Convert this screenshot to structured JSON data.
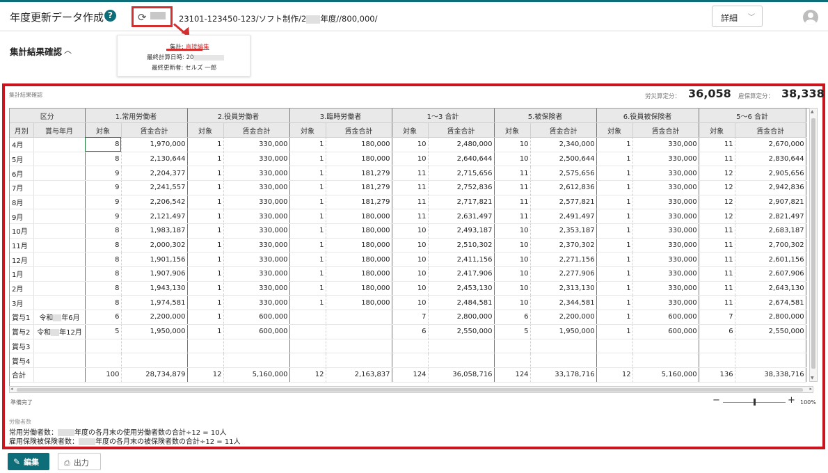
{
  "header": {
    "title": "年度更新データ作成",
    "help": "?",
    "path_prefix": "23101-123450-123/ソフト制作/2",
    "path_suffix": "年度//800,000/",
    "detail_label": "詳細",
    "history_icon": "history-icon",
    "chevron_icon": "chevron-down-icon",
    "user_icon": "user-avatar-icon"
  },
  "section": {
    "title": "集計結果確認",
    "toggle_icon": "chevron-up-icon"
  },
  "card": {
    "aggregate_label": "集計:",
    "aggregate_link": "直接編集",
    "last_calc_label": "最終計算日時:",
    "last_calc_value": "20",
    "last_user_label": "最終更新者:",
    "last_user_value": "セルズ 一郎"
  },
  "panel": {
    "title": "集計結果確認",
    "rousai_label": "労災算定分：",
    "rousai_value": "36,058",
    "koyou_label": "雇保算定分：",
    "koyou_value": "38,338"
  },
  "grid": {
    "group_headers": [
      "区分",
      "1.常用労働者",
      "2.役員労働者",
      "3.臨時労働者",
      "1～3 合計",
      "5.被保険者",
      "6.役員被保険者",
      "5～6 合計"
    ],
    "sub_headers": [
      "月別",
      "賞与年月",
      "対象",
      "賃金合計",
      "対象",
      "賃金合計",
      "対象",
      "賃金合計",
      "対象",
      "賃金合計",
      "対象",
      "賃金合計",
      "対象",
      "賃金合計",
      "対象",
      "賃金合計"
    ],
    "rows": [
      {
        "m": "4月",
        "b": "",
        "c": [
          "8",
          "1,970,000",
          "1",
          "330,000",
          "1",
          "180,000",
          "10",
          "2,480,000",
          "10",
          "2,340,000",
          "1",
          "330,000",
          "11",
          "2,670,000"
        ]
      },
      {
        "m": "5月",
        "b": "",
        "c": [
          "8",
          "2,130,644",
          "1",
          "330,000",
          "1",
          "180,000",
          "10",
          "2,640,644",
          "10",
          "2,500,644",
          "1",
          "330,000",
          "11",
          "2,830,644"
        ]
      },
      {
        "m": "6月",
        "b": "",
        "c": [
          "9",
          "2,204,377",
          "1",
          "330,000",
          "1",
          "181,279",
          "11",
          "2,715,656",
          "11",
          "2,575,656",
          "1",
          "330,000",
          "12",
          "2,905,656"
        ]
      },
      {
        "m": "7月",
        "b": "",
        "c": [
          "9",
          "2,241,557",
          "1",
          "330,000",
          "1",
          "181,279",
          "11",
          "2,752,836",
          "11",
          "2,612,836",
          "1",
          "330,000",
          "12",
          "2,942,836"
        ]
      },
      {
        "m": "8月",
        "b": "",
        "c": [
          "9",
          "2,206,542",
          "1",
          "330,000",
          "1",
          "181,279",
          "11",
          "2,717,821",
          "11",
          "2,577,821",
          "1",
          "330,000",
          "12",
          "2,907,821"
        ]
      },
      {
        "m": "9月",
        "b": "",
        "c": [
          "9",
          "2,121,497",
          "1",
          "330,000",
          "1",
          "180,000",
          "11",
          "2,631,497",
          "11",
          "2,491,497",
          "1",
          "330,000",
          "12",
          "2,821,497"
        ]
      },
      {
        "m": "10月",
        "b": "",
        "c": [
          "8",
          "1,983,187",
          "1",
          "330,000",
          "1",
          "180,000",
          "10",
          "2,493,187",
          "10",
          "2,353,187",
          "1",
          "330,000",
          "11",
          "2,683,187"
        ]
      },
      {
        "m": "11月",
        "b": "",
        "c": [
          "8",
          "2,000,302",
          "1",
          "330,000",
          "1",
          "180,000",
          "10",
          "2,510,302",
          "10",
          "2,370,302",
          "1",
          "330,000",
          "11",
          "2,700,302"
        ]
      },
      {
        "m": "12月",
        "b": "",
        "c": [
          "8",
          "1,901,156",
          "1",
          "330,000",
          "1",
          "180,000",
          "10",
          "2,411,156",
          "10",
          "2,271,156",
          "1",
          "330,000",
          "11",
          "2,601,156"
        ]
      },
      {
        "m": "1月",
        "b": "",
        "c": [
          "8",
          "1,907,906",
          "1",
          "330,000",
          "1",
          "180,000",
          "10",
          "2,417,906",
          "10",
          "2,277,906",
          "1",
          "330,000",
          "11",
          "2,607,906"
        ]
      },
      {
        "m": "2月",
        "b": "",
        "c": [
          "8",
          "1,943,130",
          "1",
          "330,000",
          "1",
          "180,000",
          "10",
          "2,453,130",
          "10",
          "2,313,130",
          "1",
          "330,000",
          "11",
          "2,643,130"
        ]
      },
      {
        "m": "3月",
        "b": "",
        "c": [
          "8",
          "1,974,581",
          "1",
          "330,000",
          "1",
          "180,000",
          "10",
          "2,484,581",
          "10",
          "2,344,581",
          "1",
          "330,000",
          "11",
          "2,674,581"
        ]
      },
      {
        "m": "賞与1",
        "b": "令和 年6月",
        "c": [
          "6",
          "2,200,000",
          "1",
          "600,000",
          "",
          "",
          "7",
          "2,800,000",
          "6",
          "2,200,000",
          "1",
          "600,000",
          "7",
          "2,800,000"
        ]
      },
      {
        "m": "賞与2",
        "b": "令和 年12月",
        "c": [
          "5",
          "1,950,000",
          "1",
          "600,000",
          "",
          "",
          "6",
          "2,550,000",
          "5",
          "1,950,000",
          "1",
          "600,000",
          "6",
          "2,550,000"
        ]
      },
      {
        "m": "賞与3",
        "b": "",
        "c": [
          "",
          "",
          "",
          "",
          "",
          "",
          "",
          "",
          "",
          "",
          "",
          "",
          "",
          ""
        ]
      },
      {
        "m": "賞与4",
        "b": "",
        "c": [
          "",
          "",
          "",
          "",
          "",
          "",
          "",
          "",
          "",
          "",
          "",
          "",
          "",
          ""
        ]
      },
      {
        "m": "合計",
        "b": "",
        "c": [
          "100",
          "28,734,879",
          "12",
          "5,160,000",
          "12",
          "2,163,837",
          "124",
          "36,058,716",
          "124",
          "33,178,716",
          "12",
          "5,160,000",
          "136",
          "38,338,716"
        ]
      }
    ]
  },
  "status": {
    "text": "準備完了",
    "zoom_minus": "−",
    "zoom_plus": "+",
    "zoom": "100%",
    "zoom_level": 0.5
  },
  "notes": {
    "title": "労働者数",
    "line1_prefix": "常用労働者数：",
    "line1_suffix": "年度の各月末の使用労働者数の合計÷12 = 10人",
    "line2_prefix": "雇用保険被保険者数：",
    "line2_suffix": "年度の各月末の被保険者数の合計÷12 = 11人"
  },
  "footer": {
    "edit_label": "編集",
    "output_label": "出力",
    "edit_icon": "pencil-icon",
    "output_icon": "printer-icon"
  },
  "colors": {
    "accent": "#0d6e7a",
    "highlight_red": "#c9151d"
  }
}
